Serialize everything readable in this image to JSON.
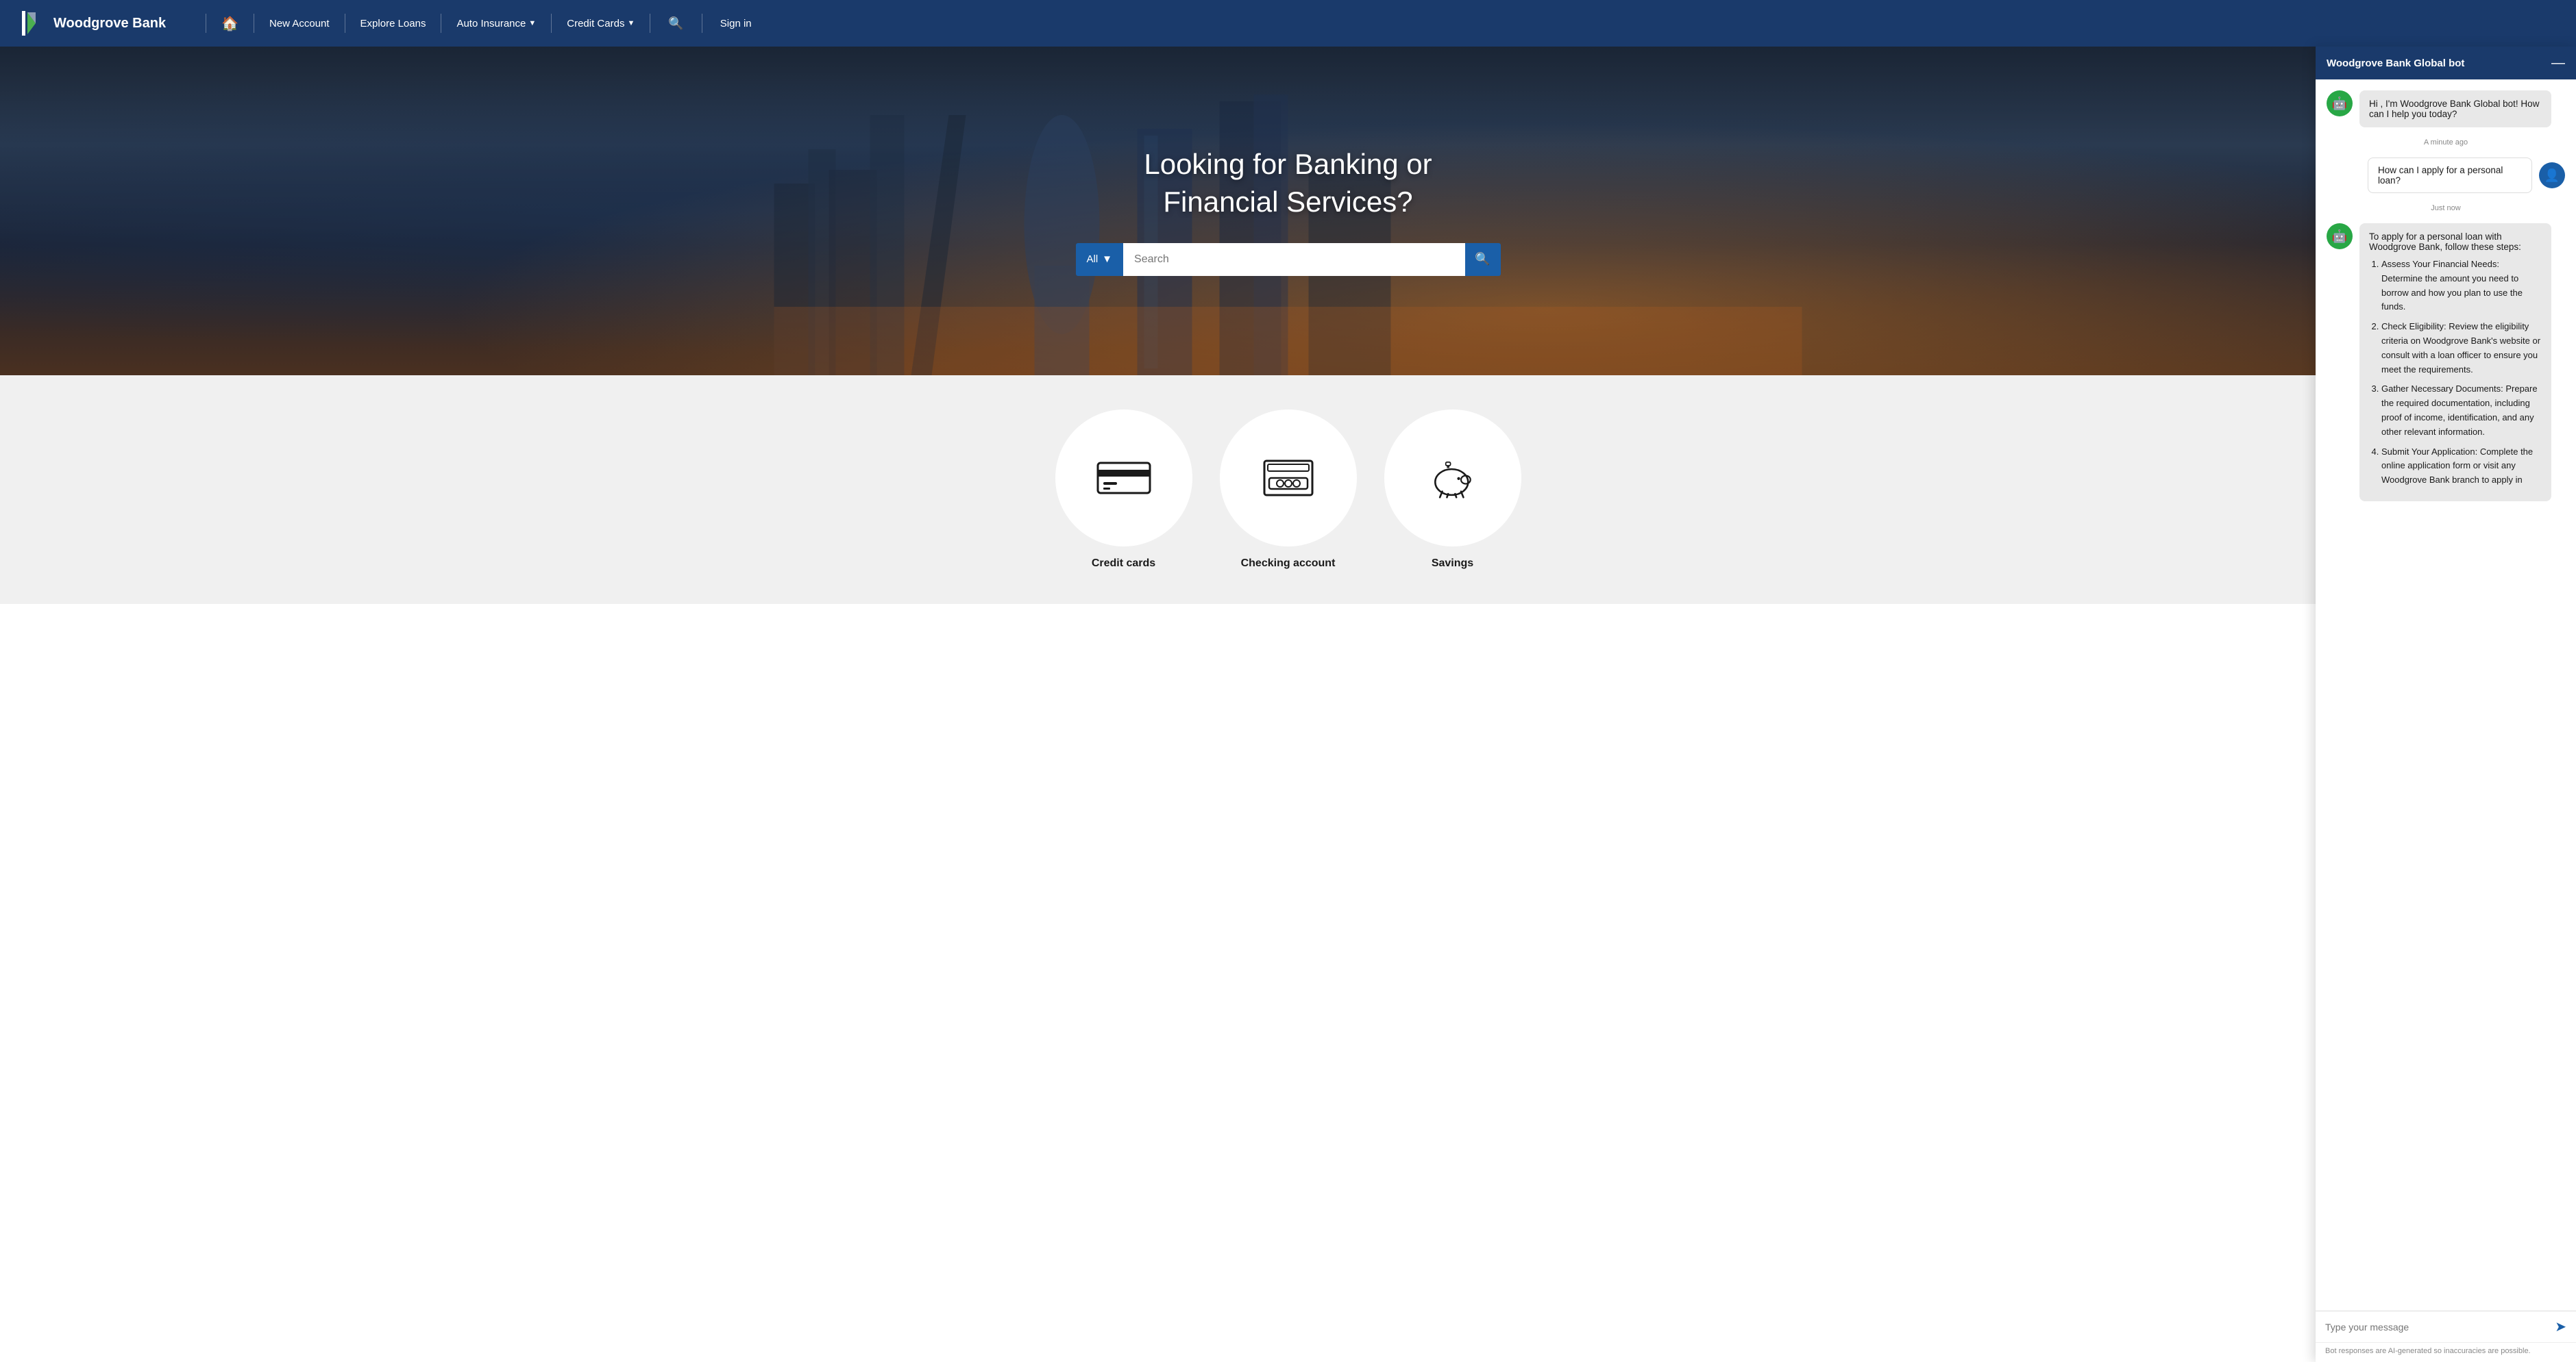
{
  "brand": {
    "name": "Woodgrove Bank",
    "logo_alt": "Woodgrove Bank Logo"
  },
  "navbar": {
    "home_label": "🏠",
    "links": [
      {
        "label": "New Account",
        "has_dropdown": false
      },
      {
        "label": "Explore Loans",
        "has_dropdown": false
      },
      {
        "label": "Auto Insurance",
        "has_dropdown": true
      },
      {
        "label": "Credit Cards",
        "has_dropdown": true
      }
    ],
    "search_label": "🔍",
    "signin_label": "Sign in"
  },
  "hero": {
    "title": "Looking for Banking or Financial Services?",
    "search": {
      "dropdown_label": "All",
      "dropdown_chevron": "▼",
      "placeholder": "Search",
      "button_icon": "🔍"
    }
  },
  "services": [
    {
      "id": "credit-cards",
      "label": "Credit cards"
    },
    {
      "id": "checking-account",
      "label": "Checking account"
    },
    {
      "id": "savings",
      "label": "Savings"
    }
  ],
  "chatbot": {
    "title": "Woodgrove Bank Global bot",
    "minimize_icon": "—",
    "messages": [
      {
        "type": "bot",
        "text": "Hi , I'm Woodgrove Bank Global bot! How can I help you today?",
        "timestamp": "A minute ago"
      },
      {
        "type": "user",
        "text": "How can I apply for a personal loan?",
        "timestamp": "Just now"
      },
      {
        "type": "bot",
        "intro": "To apply for a personal loan with Woodgrove Bank, follow these steps:",
        "steps": [
          "Assess Your Financial Needs: Determine the amount you need to borrow and how you plan to use the funds.",
          "Check Eligibility: Review the eligibility criteria on Woodgrove Bank's website or consult with a loan officer to ensure you meet the requirements.",
          "Gather Necessary Documents: Prepare the required documentation, including proof of income, identification, and any other relevant information.",
          "Submit Your Application: Complete the online application form or visit any Woodgrove Bank branch to apply in"
        ]
      }
    ],
    "input_placeholder": "Type your message",
    "send_icon": "➤",
    "footer_text": "Bot responses are AI-generated so inaccuracies are possible."
  }
}
